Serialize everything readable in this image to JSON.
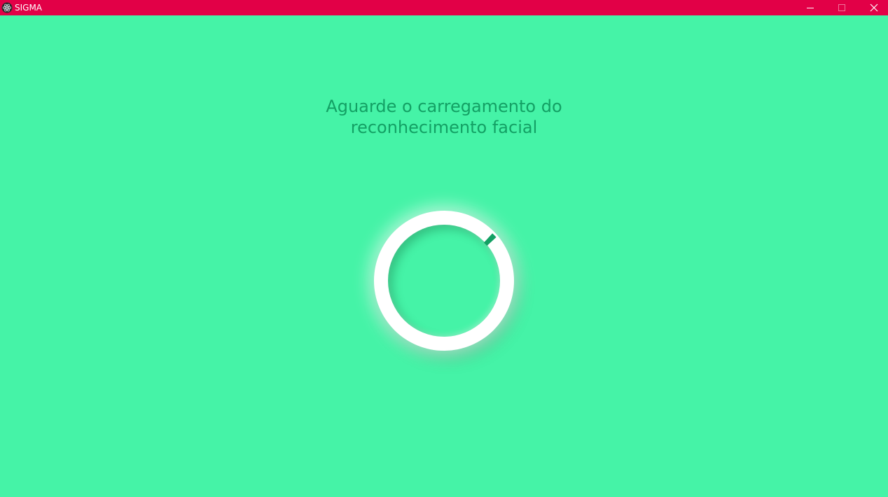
{
  "window": {
    "title": "SIGMA",
    "controls": {
      "minimize_icon": "minimize-icon",
      "maximize_icon": "maximize-icon",
      "close_icon": "close-icon"
    },
    "titlebar_color": "#e20047"
  },
  "main": {
    "heading_line1": "Aguarde o carregamento do",
    "heading_line2": "reconhecimento facial",
    "background_color": "#45f3a7",
    "text_color": "#13a064"
  },
  "loader": {
    "icon": "loading-spinner",
    "ring_color": "#ffffff",
    "indicator_color": "#13a064"
  }
}
